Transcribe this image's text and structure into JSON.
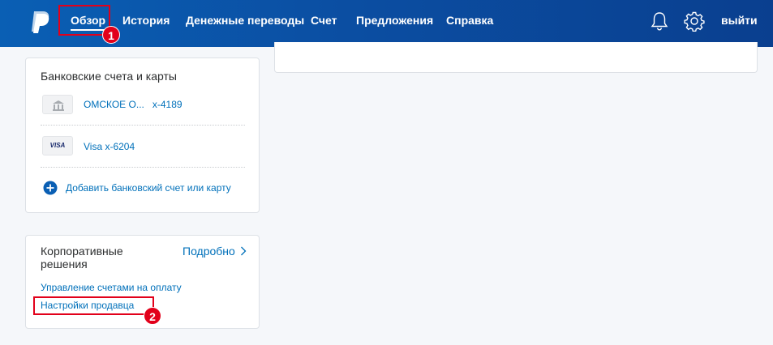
{
  "header": {
    "logo": "paypal-logo-icon",
    "nav": [
      "Обзор",
      "История",
      "Денежные переводы",
      "Счет",
      "Предложения",
      "Справка"
    ],
    "logout": "выйти",
    "icons": [
      "bell-icon",
      "gear-icon"
    ]
  },
  "annotations": {
    "one": "1",
    "two": "2"
  },
  "bank_card": {
    "title": "Банковские счета и карты",
    "accounts": [
      {
        "name": "ОМСКОЕ О...",
        "number": "x-4189",
        "icon": "bank-icon"
      },
      {
        "name": "Visa x-6204",
        "badge": "VISA",
        "icon": "visa-card-icon"
      }
    ],
    "add_link": "Добавить банковский счет или карту"
  },
  "business_card": {
    "title_line1": "Корпоративные",
    "title_line2": "решения",
    "more_link": "Подробно",
    "links": [
      "Управление счетами на оплату",
      "Настройки продавца"
    ]
  },
  "colors": {
    "header": "#0b4ea2",
    "link": "#0070ba",
    "highlight": "#e2001a"
  }
}
